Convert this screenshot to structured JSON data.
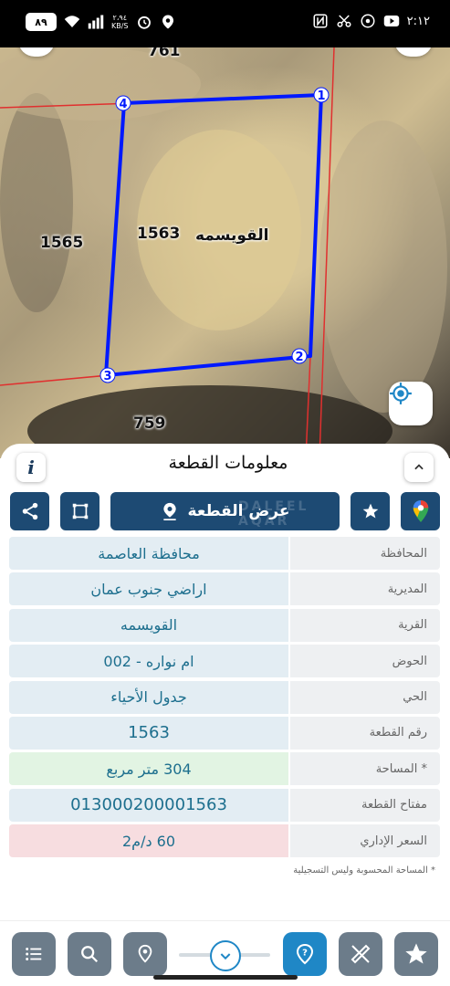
{
  "status_bar": {
    "time": "٢:١٢",
    "battery": "٨٩",
    "net_speed_value": "٢،٩٤",
    "net_speed_unit": "KB/S"
  },
  "map": {
    "parcel_labels": {
      "top": "761",
      "left": "1565",
      "center_number": "1563",
      "center_name": "القويسمه",
      "bottom": "759"
    },
    "vertices": [
      "1",
      "2",
      "3",
      "4"
    ],
    "colors": {
      "parcel_outline": "#0019ff",
      "neighbor_lines": "#e0302f"
    }
  },
  "sheet": {
    "title": "معلومات القطعة",
    "info_icon": "i",
    "show_parcel_label": "عرض القطعة",
    "watermark": "DALEEL AQAR",
    "rows": [
      {
        "label": "المحافظة",
        "value": "محافظة العاصمة"
      },
      {
        "label": "المديرية",
        "value": "اراضي جنوب عمان"
      },
      {
        "label": "القرية",
        "value": "القويسمه"
      },
      {
        "label": "الحوض",
        "value": "ام نواره - 002"
      },
      {
        "label": "الحي",
        "value": "جدول الأحياء"
      },
      {
        "label": "رقم القطعة",
        "value": "1563"
      },
      {
        "label": "المساحة *",
        "value": "304  متر مربع"
      },
      {
        "label": "مفتاح القطعة",
        "value": "013000200001563"
      },
      {
        "label": "السعر الإداري",
        "value": "60 د/م2"
      }
    ],
    "footnote": "* المساحة المحسوبة وليس التسجيلية"
  },
  "colors": {
    "primary": "#1d4a73",
    "accent": "#1f87c6",
    "value_text": "#1d6f8e"
  }
}
